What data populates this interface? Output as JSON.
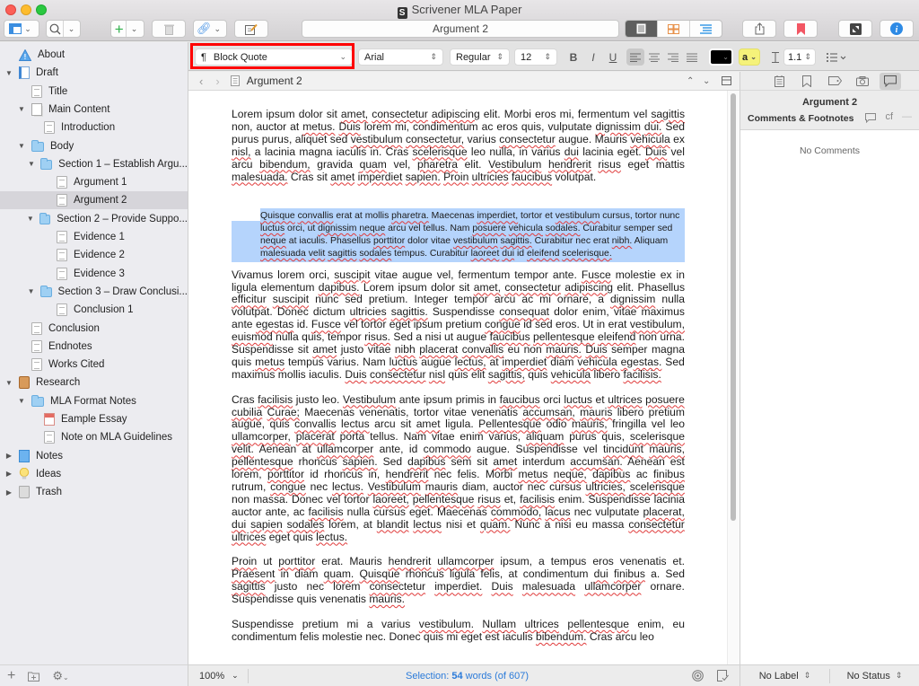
{
  "window": {
    "title": "Scrivener MLA Paper",
    "toolbar_title": "Argument 2"
  },
  "toolbar": {
    "view_mode_options": [
      "document",
      "corkboard",
      "outliner"
    ],
    "view_mode_selected": "document",
    "icons": [
      "binder-toggle-icon",
      "search-icon",
      "add-icon",
      "trash-icon",
      "attach-icon",
      "compose-icon",
      "share-icon",
      "bookmark-icon",
      "fullscreen-icon",
      "info-icon"
    ]
  },
  "format_bar": {
    "paragraph_style": "Block Quote",
    "paragraph_icon": "¶",
    "font_family": "Arial",
    "font_style": "Regular",
    "font_size": "12",
    "bold": "B",
    "italic": "I",
    "underline": "U",
    "alignment_selected": "left",
    "text_color": "#000000",
    "highlight_label": "a",
    "highlight_color": "#f5f27a",
    "line_spacing": "1.1"
  },
  "binder": {
    "items": [
      {
        "label": "About",
        "icon": "about",
        "level": 0,
        "disclosure": "",
        "selected": false
      },
      {
        "label": "Draft",
        "icon": "draft",
        "level": 0,
        "disclosure": "▼",
        "selected": false
      },
      {
        "label": "Title",
        "icon": "doc",
        "level": 1,
        "disclosure": "",
        "selected": false
      },
      {
        "label": "Main Content",
        "icon": "stack",
        "level": 1,
        "disclosure": "▼",
        "selected": false
      },
      {
        "label": "Introduction",
        "icon": "doc",
        "level": 2,
        "disclosure": "",
        "selected": false
      },
      {
        "label": "Body",
        "icon": "folder",
        "level": 1,
        "disclosure": "▼",
        "selected": false
      },
      {
        "label": "Section 1 – Establish Argu...",
        "icon": "folder",
        "level": 2,
        "disclosure": "▼",
        "selected": false
      },
      {
        "label": "Argument 1",
        "icon": "doc",
        "level": 3,
        "disclosure": "",
        "selected": false
      },
      {
        "label": "Argument 2",
        "icon": "doc",
        "level": 3,
        "disclosure": "",
        "selected": true
      },
      {
        "label": "Section 2 – Provide Suppo...",
        "icon": "folder",
        "level": 2,
        "disclosure": "▼",
        "selected": false
      },
      {
        "label": "Evidence 1",
        "icon": "doc",
        "level": 3,
        "disclosure": "",
        "selected": false
      },
      {
        "label": "Evidence 2",
        "icon": "doc",
        "level": 3,
        "disclosure": "",
        "selected": false
      },
      {
        "label": "Evidence 3",
        "icon": "doc",
        "level": 3,
        "disclosure": "",
        "selected": false
      },
      {
        "label": "Section 3 – Draw Conclusi...",
        "icon": "folder",
        "level": 2,
        "disclosure": "▼",
        "selected": false
      },
      {
        "label": "Conclusion 1",
        "icon": "doc",
        "level": 3,
        "disclosure": "",
        "selected": false
      },
      {
        "label": "Conclusion",
        "icon": "doc",
        "level": 1,
        "disclosure": "",
        "selected": false
      },
      {
        "label": "Endnotes",
        "icon": "doc",
        "level": 1,
        "disclosure": "",
        "selected": false
      },
      {
        "label": "Works Cited",
        "icon": "doc",
        "level": 1,
        "disclosure": "",
        "selected": false
      },
      {
        "label": "Research",
        "icon": "research",
        "level": 0,
        "disclosure": "▼",
        "selected": false
      },
      {
        "label": "MLA Format Notes",
        "icon": "folder",
        "level": 1,
        "disclosure": "▼",
        "selected": false
      },
      {
        "label": "Eample Essay",
        "icon": "pdf",
        "level": 2,
        "disclosure": "",
        "selected": false
      },
      {
        "label": "Note on MLA Guidelines",
        "icon": "doc",
        "level": 2,
        "disclosure": "",
        "selected": false
      },
      {
        "label": "Notes",
        "icon": "notes",
        "level": 0,
        "disclosure": "▶",
        "selected": false
      },
      {
        "label": "Ideas",
        "icon": "idea",
        "level": 0,
        "disclosure": "▶",
        "selected": false
      },
      {
        "label": "Trash",
        "icon": "trash",
        "level": 0,
        "disclosure": "▶",
        "selected": false
      }
    ]
  },
  "editor": {
    "header_title": "Argument 2",
    "paragraphs": [
      {
        "style": "body",
        "text": "Lorem ipsum dolor sit amet, consectetur adipiscing elit. Morbi eros mi, fermentum vel sagittis non, auctor at metus. Duis lorem mi, condimentum ac eros quis, vulputate dignissim dui. Sed purus purus, aliquet sed vestibulum consectetur, varius consectetur augue. Mauris vehicula ex nisl, a lacinia magna iaculis in. Cras scelerisque leo nulla, in varius dui lacinia eget. Duis vel arcu bibendum, gravida quam vel, pharetra elit. Vestibulum hendrerit risus eget mattis malesuada. Cras sit amet imperdiet sapien. Proin ultricies faucibus volutpat."
      },
      {
        "style": "block-quote",
        "text": "Quisque convallis erat at mollis pharetra. Maecenas imperdiet, tortor et vestibulum cursus, tortor nunc luctus orci, ut dignissim neque arcu vel tellus. Nam posuere vehicula sodales. Curabitur semper sed neque at iaculis. Phasellus porttitor dolor vitae vestibulum sagittis. Curabitur nec erat nibh. Aliquam malesuada velit sagittis sodales tempus. Curabitur laoreet dui id eleifend scelerisque."
      },
      {
        "style": "body",
        "text": "Vivamus lorem orci, suscipit vitae augue vel, fermentum tempor ante. Fusce molestie ex in ligula elementum dapibus. Lorem ipsum dolor sit amet, consectetur adipiscing elit. Phasellus efficitur suscipit nunc sed pretium. Integer tempor arcu ac mi ornare, a dignissim nulla volutpat. Donec dictum ultricies sagittis. Suspendisse consequat dolor enim, vitae maximus ante egestas id. Fusce vel tortor eget ipsum pretium congue id sed eros. Ut in erat vestibulum, euismod nulla quis, tempor risus. Sed a nisi ut augue faucibus pellentesque eleifend non urna. Suspendisse sit amet justo vitae nibh placerat convallis eu non mauris. Duis semper magna quis metus tempus varius. Nam luctus augue lectus, at imperdiet diam vehicula egestas. Sed maximus mollis iaculis. Duis consectetur nisl quis elit sagittis, quis vehicula libero facilisis."
      },
      {
        "style": "body",
        "text": "Cras facilisis justo leo. Vestibulum ante ipsum primis in faucibus orci luctus et ultrices posuere cubilia Curae; Maecenas venenatis, tortor vitae venenatis accumsan, mauris libero pretium augue, quis convallis lectus arcu sit amet ligula. Pellentesque odio mauris, fringilla vel leo ullamcorper, placerat porta tellus. Nam vitae enim varius, aliquam purus quis, scelerisque velit. Aenean at ullamcorper ante, id commodo augue. Suspendisse vel tincidunt mauris, pellentesque rhoncus sapien. Sed dapibus sem sit amet interdum accumsan. Aenean est lorem, porttitor id rhoncus in, hendrerit nec felis. Morbi metus neque, dapibus ac finibus rutrum, congue nec lectus. Vestibulum mauris diam, auctor nec cursus ultricies, scelerisque non massa. Donec vel tortor laoreet, pellentesque risus et, facilisis enim. Suspendisse lacinia auctor ante, ac facilisis nulla cursus eget. Maecenas commodo, lacus nec vulputate placerat, dui sapien sodales lorem, at blandit lectus nisi et quam. Nunc a nisi eu massa consectetur ultrices eget quis lectus."
      },
      {
        "style": "body",
        "text": "Proin ut porttitor erat. Mauris hendrerit ullamcorper ipsum, a tempus eros venenatis et. Praesent in diam quam. Quisque rhoncus ligula felis, at condimentum dui finibus a. Sed sagittis justo nec lorem consectetur imperdiet. Duis malesuada ullamcorper ornare. Suspendisse quis venenatis mauris."
      },
      {
        "style": "body",
        "text": "Suspendisse pretium mi a varius vestibulum. Nullam ultrices pellentesque enim, eu condimentum felis molestie nec. Donec quis mi eget est iaculis bibendum. Cras arcu leo"
      }
    ],
    "spelling_flagged": [
      "amet",
      "consectetur",
      "adipiscing",
      "sagittis",
      "metus",
      "Duis",
      "dignissim",
      "dui",
      "vestibulum",
      "vehicula",
      "nisl",
      "scelerisque",
      "bibendum",
      "quam",
      "pharetra",
      "Vestibulum",
      "hendrerit",
      "risus",
      "malesuada",
      "imperdiet",
      "sapien",
      "Proin",
      "ultricies",
      "faucibus",
      "Quisque",
      "convallis",
      "luctus",
      "neque",
      "posuere",
      "porttitor",
      "nibh",
      "velit",
      "sodales",
      "laoreet",
      "eleifend",
      "suscipit",
      "Fusce",
      "dapibus",
      "efficitur",
      "consequat",
      "egestas",
      "congue",
      "euismod",
      "pellentesque",
      "mauris",
      "lectus",
      "nisl",
      "facilisis",
      "Curae",
      "accumsan",
      "Pellentesque",
      "ullamcorper",
      "aliquam",
      "commodo",
      "tincidunt",
      "finibus",
      "lacus",
      "blandit",
      "Praesent",
      "Nullam",
      "ultrices",
      "cubilia",
      "placerat"
    ]
  },
  "status_bar": {
    "zoom": "100%",
    "selection_prefix": "Selection: ",
    "selection_count": "54",
    "selection_suffix": " words (of 607)"
  },
  "inspector": {
    "tabs": [
      "notes-icon",
      "bookmarks-icon",
      "metadata-icon",
      "snapshots-icon",
      "comments-icon"
    ],
    "active_tab": "comments-icon",
    "title": "Argument 2",
    "section_label": "Comments & Footnotes",
    "footnote_label": "cf",
    "empty_text": "No Comments",
    "label_select": "No Label",
    "status_select": "No Status"
  }
}
